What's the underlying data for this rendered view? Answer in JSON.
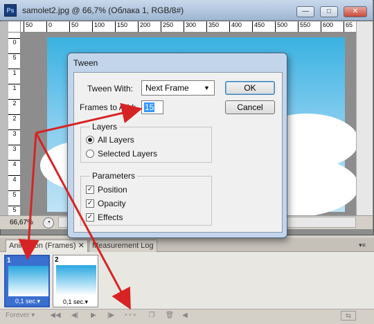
{
  "document": {
    "title": "samolet2.jpg @ 66,7% (Облака 1, RGB/8#)",
    "zoom": "66,67%",
    "ruler_top_ticks": [
      "50",
      "0",
      "50",
      "100",
      "150",
      "200",
      "250",
      "300",
      "350",
      "400",
      "450",
      "500",
      "550",
      "600",
      "65"
    ],
    "ruler_left_ticks": [
      "0",
      "5",
      "1",
      "1",
      "2",
      "2",
      "3",
      "3",
      "4",
      "4",
      "5",
      "5"
    ],
    "window_buttons": {
      "minimize": "—",
      "restore": "□",
      "close": "✕"
    }
  },
  "dialog": {
    "title": "Tween",
    "tween_with_label": "Tween With:",
    "tween_with_value": "Next Frame",
    "frames_to_add_label": "Frames to Add:",
    "frames_to_add_value": "15",
    "ok_label": "OK",
    "cancel_label": "Cancel",
    "layers": {
      "title": "Layers",
      "options": [
        "All Layers",
        "Selected Layers"
      ],
      "selected": "All Layers"
    },
    "parameters": {
      "title": "Parameters",
      "items": [
        {
          "label": "Position",
          "checked": true
        },
        {
          "label": "Opacity",
          "checked": true
        },
        {
          "label": "Effects",
          "checked": true
        }
      ]
    }
  },
  "animation_panel": {
    "tabs": [
      "Animation (Frames)",
      "Measurement Log"
    ],
    "frames": [
      {
        "number": "1",
        "delay": "0,1 sec.",
        "selected": true
      },
      {
        "number": "2",
        "delay": "0,1 sec.",
        "selected": false
      }
    ],
    "loop_label": "Forever"
  },
  "colors": {
    "arrow": "#d62424",
    "selected_frame": "#3a6fd0",
    "sky_top": "#3ab2e2"
  }
}
